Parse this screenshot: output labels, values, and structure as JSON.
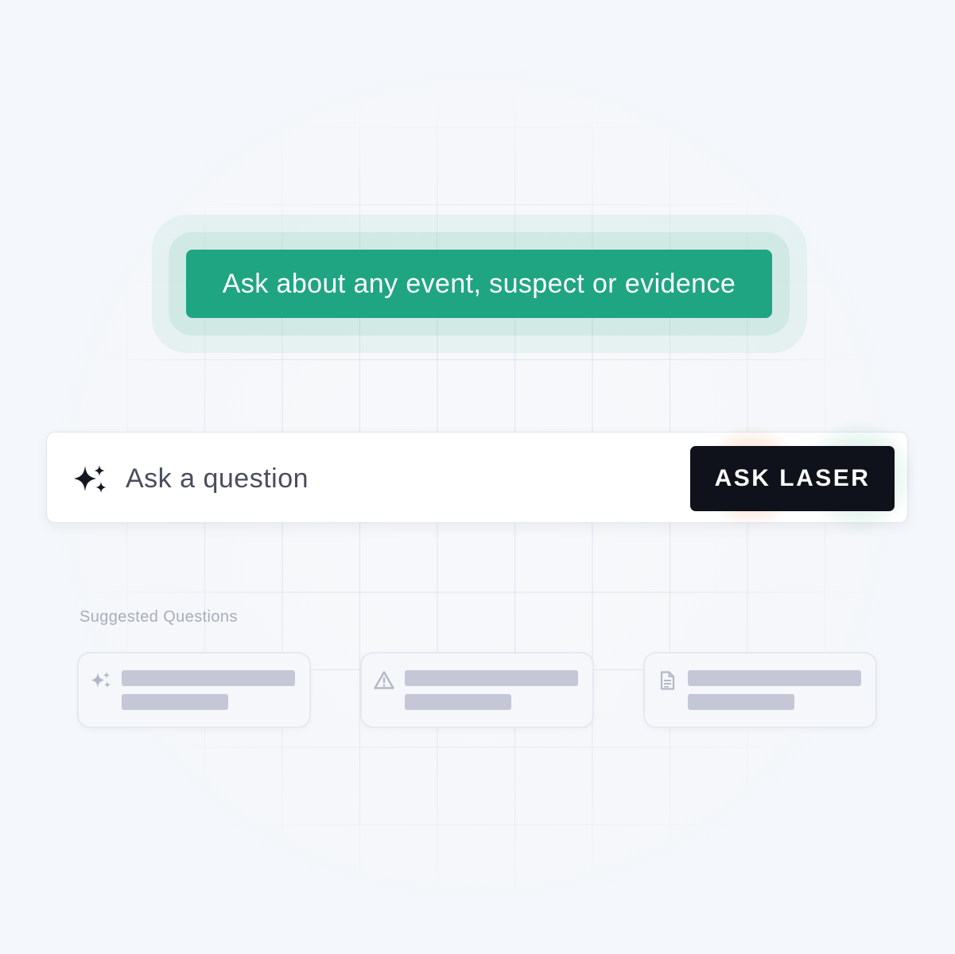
{
  "callout": {
    "text": "Ask about any event, suspect or evidence",
    "color": "#20a583"
  },
  "search": {
    "icon": "sparkle-icon",
    "placeholder": "Ask a question",
    "button_label": "ASK LASER",
    "button_color": "#10121b"
  },
  "suggestions": {
    "heading": "Suggested Questions",
    "cards": [
      {
        "icon": "sparkle-icon"
      },
      {
        "icon": "warning-icon"
      },
      {
        "icon": "document-icon"
      }
    ]
  }
}
